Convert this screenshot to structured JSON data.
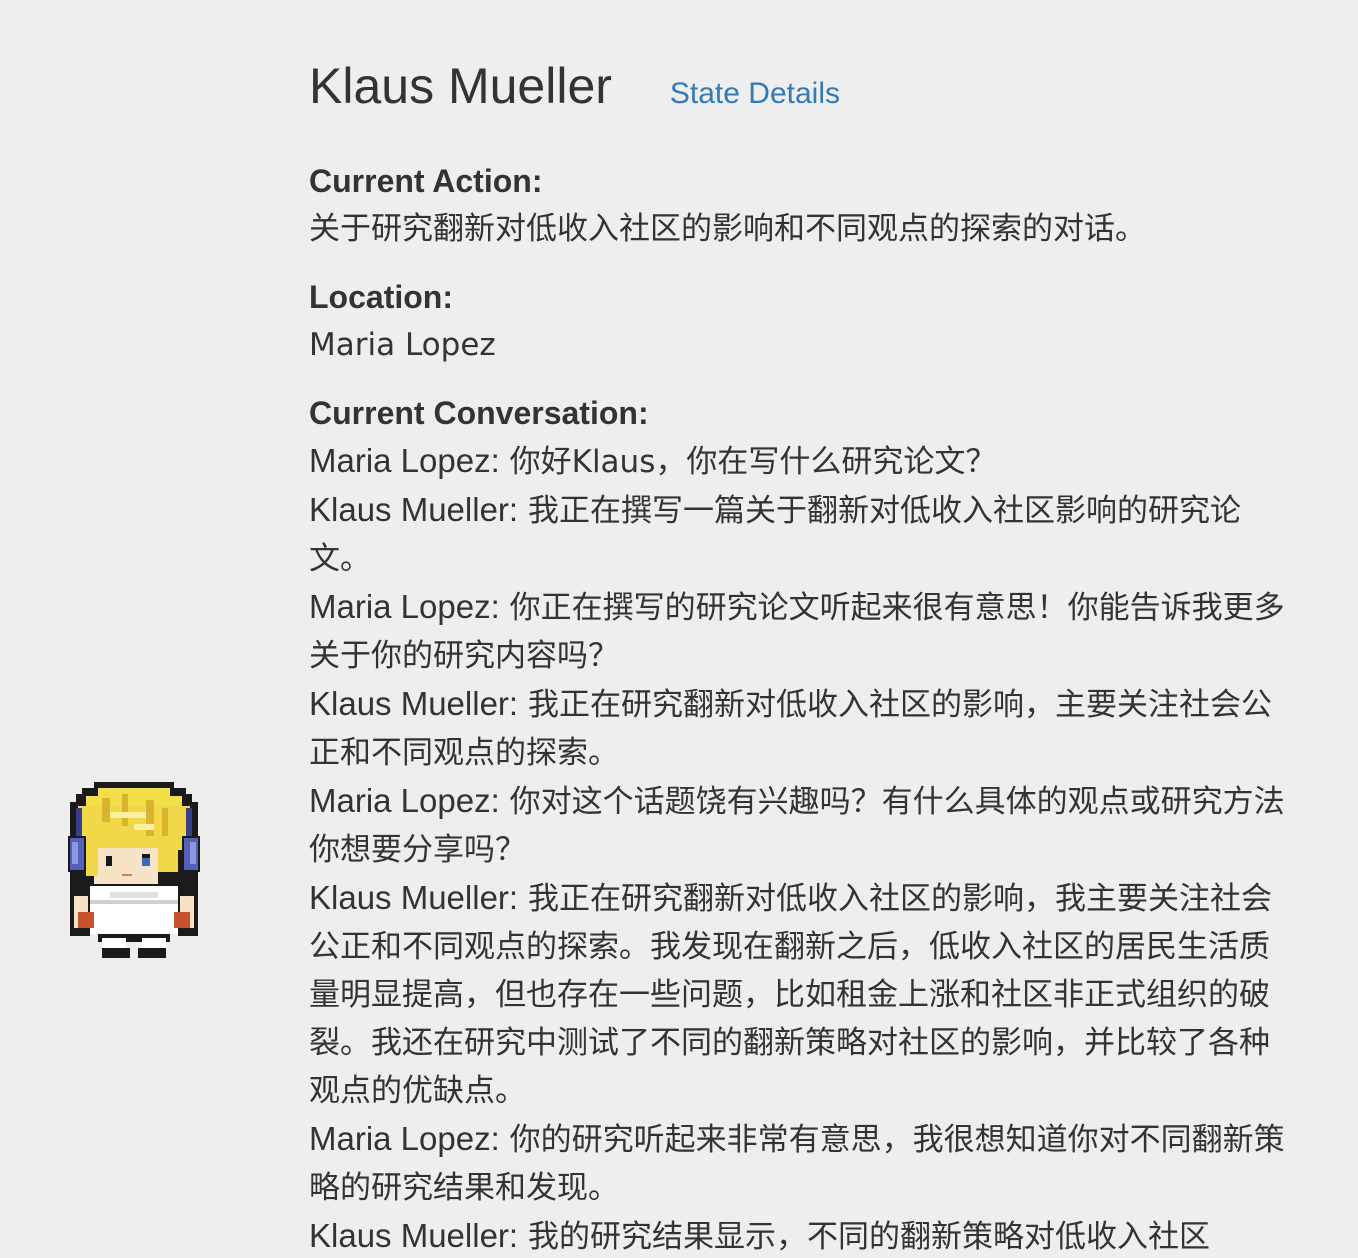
{
  "persona": {
    "name": "Klaus Mueller",
    "state_details_link": "State Details"
  },
  "current_action": {
    "label": "Current Action:",
    "value": "关于研究翻新对低收入社区的影响和不同观点的探索的对话。"
  },
  "location": {
    "label": "Location:",
    "value": "Maria Lopez"
  },
  "conversation": {
    "label": "Current Conversation:",
    "lines": [
      {
        "speaker": "Maria Lopez:",
        "text": " 你好Klaus，你在写什么研究论文？"
      },
      {
        "speaker": "Klaus Mueller:",
        "text": " 我正在撰写一篇关于翻新对低收入社区影响的研究论文。"
      },
      {
        "speaker": "Maria Lopez:",
        "text": " 你正在撰写的研究论文听起来很有意思！你能告诉我更多关于你的研究内容吗？"
      },
      {
        "speaker": "Klaus Mueller:",
        "text": " 我正在研究翻新对低收入社区的影响，主要关注社会公正和不同观点的探索。"
      },
      {
        "speaker": "Maria Lopez:",
        "text": " 你对这个话题饶有兴趣吗？有什么具体的观点或研究方法你想要分享吗？"
      },
      {
        "speaker": "Klaus Mueller:",
        "text": " 我正在研究翻新对低收入社区的影响，我主要关注社会公正和不同观点的探索。我发现在翻新之后，低收入社区的居民生活质量明显提高，但也存在一些问题，比如租金上涨和社区非正式组织的破裂。我还在研究中测试了不同的翻新策略对社区的影响，并比较了各种观点的优缺点。"
      },
      {
        "speaker": "Maria Lopez:",
        "text": " 你的研究听起来非常有意思，我很想知道你对不同翻新策略的研究结果和发现。"
      },
      {
        "speaker": "Klaus Mueller:",
        "text": " 我的研究结果显示，不同的翻新策略对低收入社区"
      }
    ]
  },
  "colors": {
    "background": "#eeeeee",
    "text": "#333333",
    "link": "#337ab7"
  }
}
